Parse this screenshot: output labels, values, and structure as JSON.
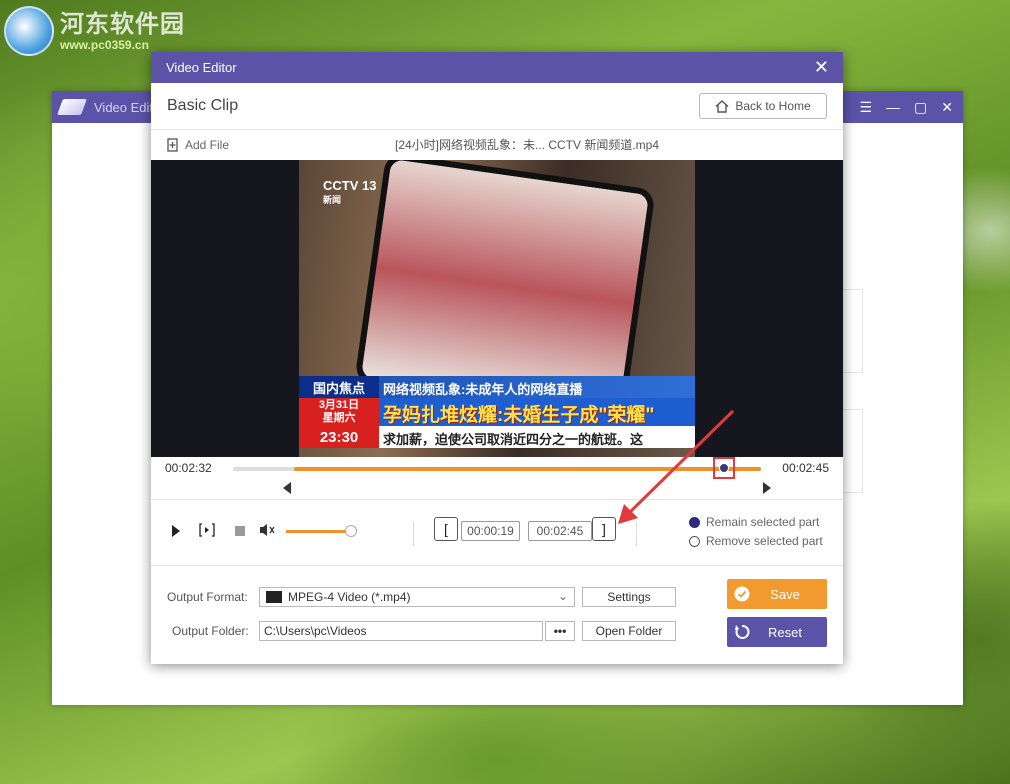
{
  "watermark": {
    "title": "河东软件园",
    "url": "www.pc0359.cn"
  },
  "background_window": {
    "title": "Video Edito"
  },
  "dialog": {
    "title": "Video Editor",
    "heading": "Basic Clip",
    "back_home_label": "Back to Home",
    "add_file_label": "Add File",
    "file_name": "[24小时]网络视频乱象：未... CCTV 新闻频道.mp4"
  },
  "video_frame": {
    "channel_logo": "CCTV 13",
    "channel_sub": "新闻",
    "tag": "国内焦点",
    "headline": "网络视频乱象:未成年人的网络直播",
    "date_line1": "3月31日",
    "date_line2": "星期六",
    "big_caption": "孕妈扎堆炫耀:未婚生子成\"荣耀\"",
    "clock": "23:30",
    "ticker": "求加薪，迫使公司取消近四分之一的航班。这"
  },
  "timeline": {
    "start_time": "00:02:32",
    "end_time": "00:02:45",
    "selection_start": 0.115,
    "selection_end": 1.0,
    "playhead": 0.93
  },
  "controls": {
    "volume": 0.92,
    "start_value": "00:00:19",
    "end_value": "00:02:45",
    "remain_label": "Remain selected part",
    "remove_label": "Remove selected part",
    "remain_selected": true
  },
  "output": {
    "format_label": "Output Format:",
    "format_value": "MPEG-4 Video (*.mp4)",
    "settings_label": "Settings",
    "folder_label": "Output Folder:",
    "folder_value": "C:\\Users\\pc\\Videos",
    "browse_label": "•••",
    "open_folder_label": "Open Folder",
    "save_label": "Save",
    "reset_label": "Reset"
  },
  "colors": {
    "accent_purple": "#5b53a8",
    "accent_orange": "#f29a2e",
    "highlight_red": "#e23a3a"
  }
}
